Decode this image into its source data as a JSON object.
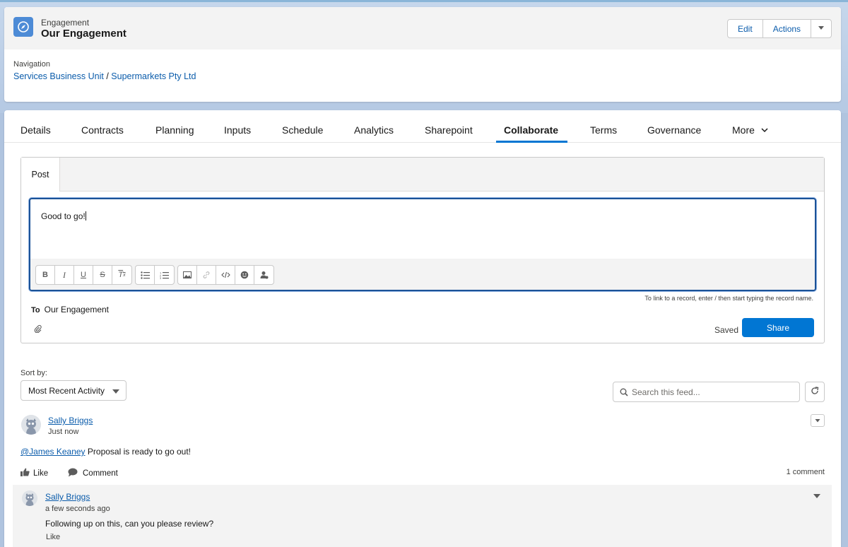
{
  "header": {
    "object_type": "Engagement",
    "title": "Our Engagement",
    "edit_label": "Edit",
    "actions_label": "Actions",
    "navigation_label": "Navigation",
    "breadcrumb": {
      "item1": "Services Business Unit",
      "separator": "/",
      "item2": "Supermarkets Pty Ltd"
    }
  },
  "tabs": [
    {
      "label": "Details"
    },
    {
      "label": "Contracts"
    },
    {
      "label": "Planning"
    },
    {
      "label": "Inputs"
    },
    {
      "label": "Schedule"
    },
    {
      "label": "Analytics"
    },
    {
      "label": "Sharepoint"
    },
    {
      "label": "Collaborate"
    },
    {
      "label": "Terms"
    },
    {
      "label": "Governance"
    },
    {
      "label": "More"
    }
  ],
  "active_tab": "Collaborate",
  "publisher": {
    "tab_label": "Post",
    "editor_text": "Good to go!",
    "hint": "To link to a record, enter / then start typing the record name.",
    "to_label": "To",
    "to_value": "Our Engagement",
    "saved_label": "Saved",
    "share_label": "Share"
  },
  "feed": {
    "sort_label": "Sort by:",
    "sort_value": "Most Recent Activity",
    "search_placeholder": "Search this feed..."
  },
  "post": {
    "author": "Sally Briggs",
    "time": "Just now",
    "mention": "@James Keaney",
    "body": " Proposal is ready to go out!",
    "like_label": "Like",
    "comment_label": "Comment",
    "comment_count": "1 comment"
  },
  "comment": {
    "author": "Sally Briggs",
    "time": "a few seconds ago",
    "body": "Following up on this, can you please review?",
    "like_label": "Like"
  },
  "colors": {
    "brand": "#0176d3",
    "link": "#0b5cab",
    "object_icon": "#4d8bd6"
  }
}
